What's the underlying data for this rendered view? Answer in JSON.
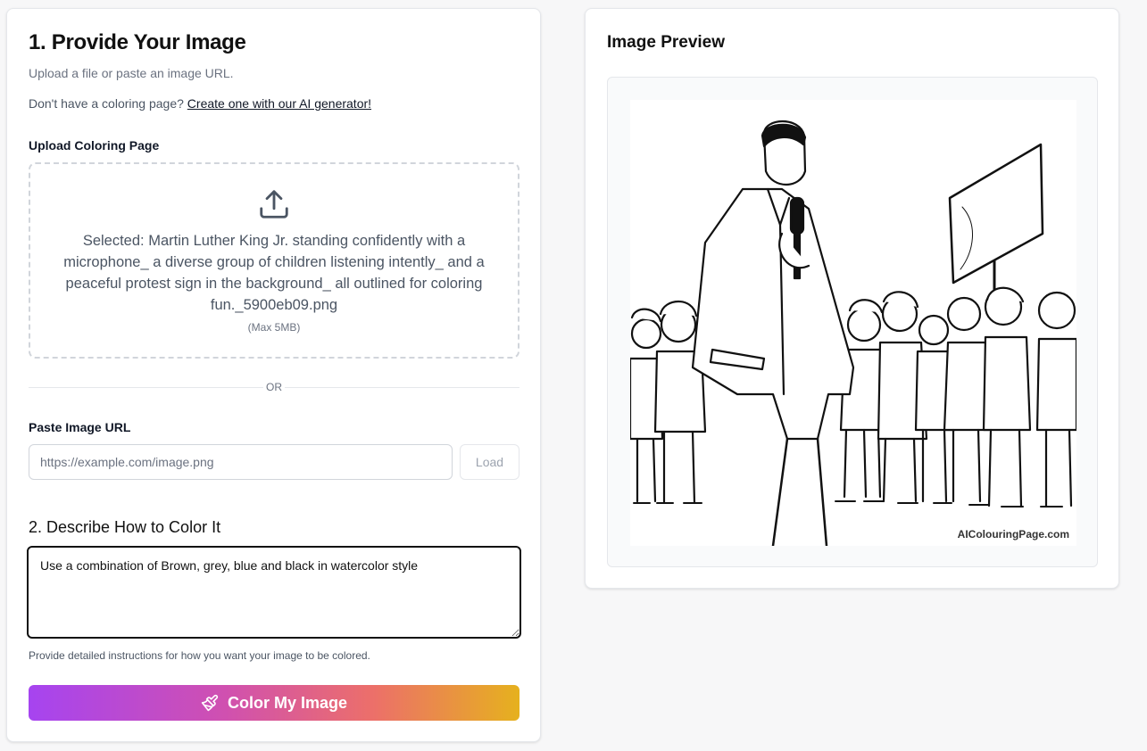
{
  "form": {
    "title": "1. Provide Your Image",
    "subtitle": "Upload a file or paste an image URL.",
    "generator_prompt": "Don't have a coloring page?",
    "generator_link": "Create one with our AI generator!",
    "upload_label": "Upload Coloring Page",
    "upload": {
      "icon": "upload-icon",
      "selected_text": "Selected: Martin Luther King Jr. standing confidently with a microphone_ a diverse group of children listening intently_ and a peaceful protest sign in the background_ all outlined for coloring fun._5900eb09.png",
      "max_size": "(Max 5MB)"
    },
    "or_label": "OR",
    "url_label": "Paste Image URL",
    "url_placeholder": "https://example.com/image.png",
    "url_value": "",
    "load_label": "Load",
    "describe_title": "2. Describe How to Color It",
    "describe_value": "Use a combination of Brown, grey, blue and black in watercolor style",
    "describe_hint": "Provide detailed instructions for how you want your image to be colored.",
    "submit_label": "Color My Image",
    "submit_icon": "paintbrush-icon"
  },
  "preview": {
    "title": "Image Preview",
    "watermark": "AIColouringPage.com"
  },
  "colors": {
    "gradient_start": "#a644f0",
    "gradient_mid": "#ec6f6a",
    "gradient_end": "#e6b11e"
  }
}
